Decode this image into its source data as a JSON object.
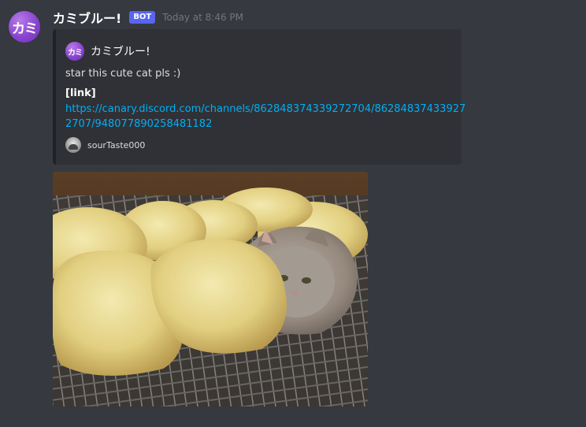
{
  "author": {
    "avatar_text": "カミ",
    "username": "カミブルー!",
    "bot_tag": "BOT",
    "timestamp": "Today at 8:46 PM"
  },
  "embed": {
    "author_avatar_text": "カミ",
    "author_name": "カミブルー!",
    "description": "star this cute cat pls :)",
    "field_name": "[link]",
    "link_line1": "https://canary.discord.com/channels/862848374339272704/86284837433927",
    "link_line2": "2707/948077890258481182",
    "footer_text": "sourTaste000"
  },
  "colors": {
    "background": "#36393f",
    "embed_background": "#2f3136",
    "link": "#00aff4",
    "bot_tag": "#5865f2"
  }
}
